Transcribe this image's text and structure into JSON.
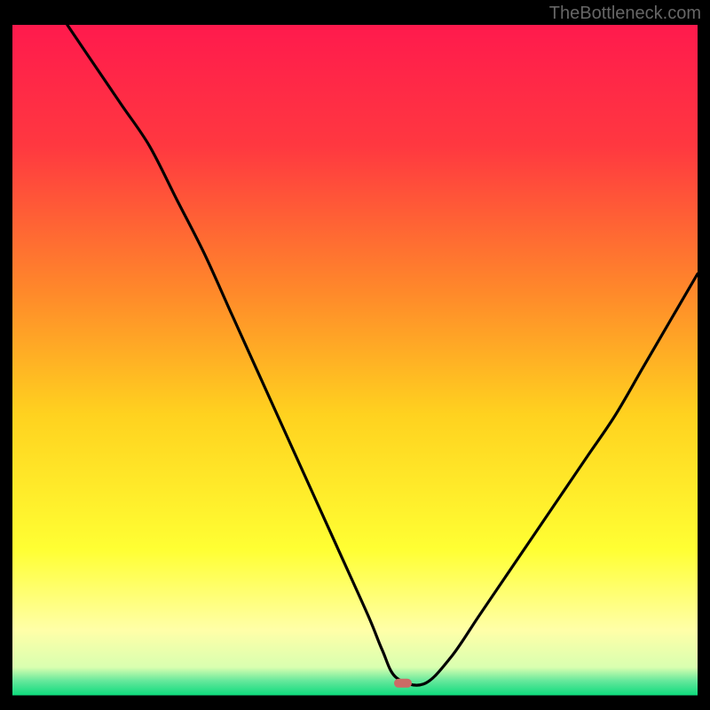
{
  "watermark": "TheBottleneck.com",
  "chart_data": {
    "type": "line",
    "title": "",
    "xlabel": "",
    "ylabel": "",
    "x_range": [
      0,
      100
    ],
    "y_range": [
      0,
      100
    ],
    "gradient_stops": [
      {
        "offset": 0.0,
        "color": "#ff1a4d"
      },
      {
        "offset": 0.18,
        "color": "#ff3840"
      },
      {
        "offset": 0.4,
        "color": "#ff8a2a"
      },
      {
        "offset": 0.58,
        "color": "#ffd21f"
      },
      {
        "offset": 0.78,
        "color": "#ffff33"
      },
      {
        "offset": 0.9,
        "color": "#ffffa8"
      },
      {
        "offset": 0.955,
        "color": "#d9ffb0"
      },
      {
        "offset": 0.975,
        "color": "#66e89c"
      },
      {
        "offset": 1.0,
        "color": "#00d877"
      }
    ],
    "curve": {
      "description": "Bottleneck curve (V-shape). High at left, drops steeply to a flat minimum around x≈55–60, then rises again toward right.",
      "x": [
        8,
        12,
        16,
        20,
        24,
        28,
        32,
        36,
        40,
        44,
        48,
        52,
        54,
        56,
        60,
        64,
        68,
        72,
        76,
        80,
        84,
        88,
        92,
        96,
        100
      ],
      "y": [
        100,
        94,
        88,
        82,
        74,
        66,
        57,
        48,
        39,
        30,
        21,
        12,
        7,
        3,
        2,
        6,
        12,
        18,
        24,
        30,
        36,
        42,
        49,
        56,
        63
      ]
    },
    "marker": {
      "description": "Optimal point marker (small rounded pill) at valley bottom",
      "x": 57,
      "y": 2,
      "color": "#cc6b66"
    }
  }
}
